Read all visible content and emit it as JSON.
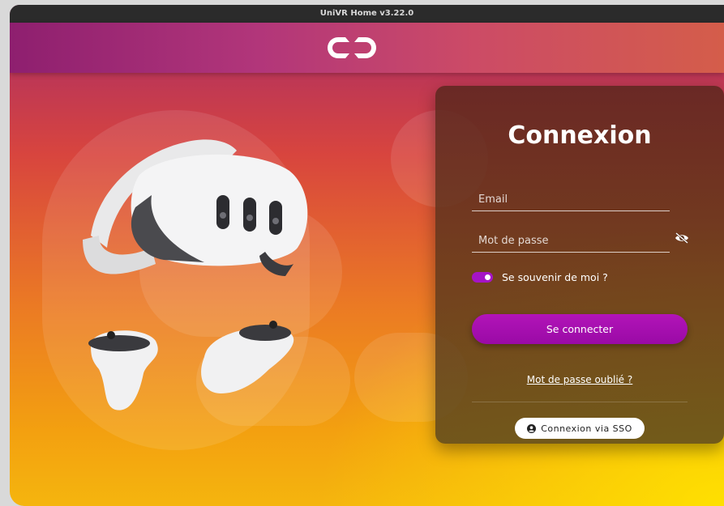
{
  "window": {
    "title": "UniVR Home v3.22.0"
  },
  "login": {
    "title": "Connexion",
    "email_placeholder": "Email",
    "password_placeholder": "Mot de passe",
    "remember_label": "Se souvenir de moi ?",
    "remember_checked": true,
    "submit_label": "Se connecter",
    "forgot_link": "Mot de passe oublié ?",
    "sso_label": "Connexion via SSO"
  },
  "icons": {
    "logo": "univr-logo-icon",
    "password_visibility": "eye-slash-icon",
    "sso": "user-circle-icon"
  },
  "colors": {
    "accent": "#a514c6",
    "button": "#9a0aa6",
    "topbar": "#b2367a"
  }
}
